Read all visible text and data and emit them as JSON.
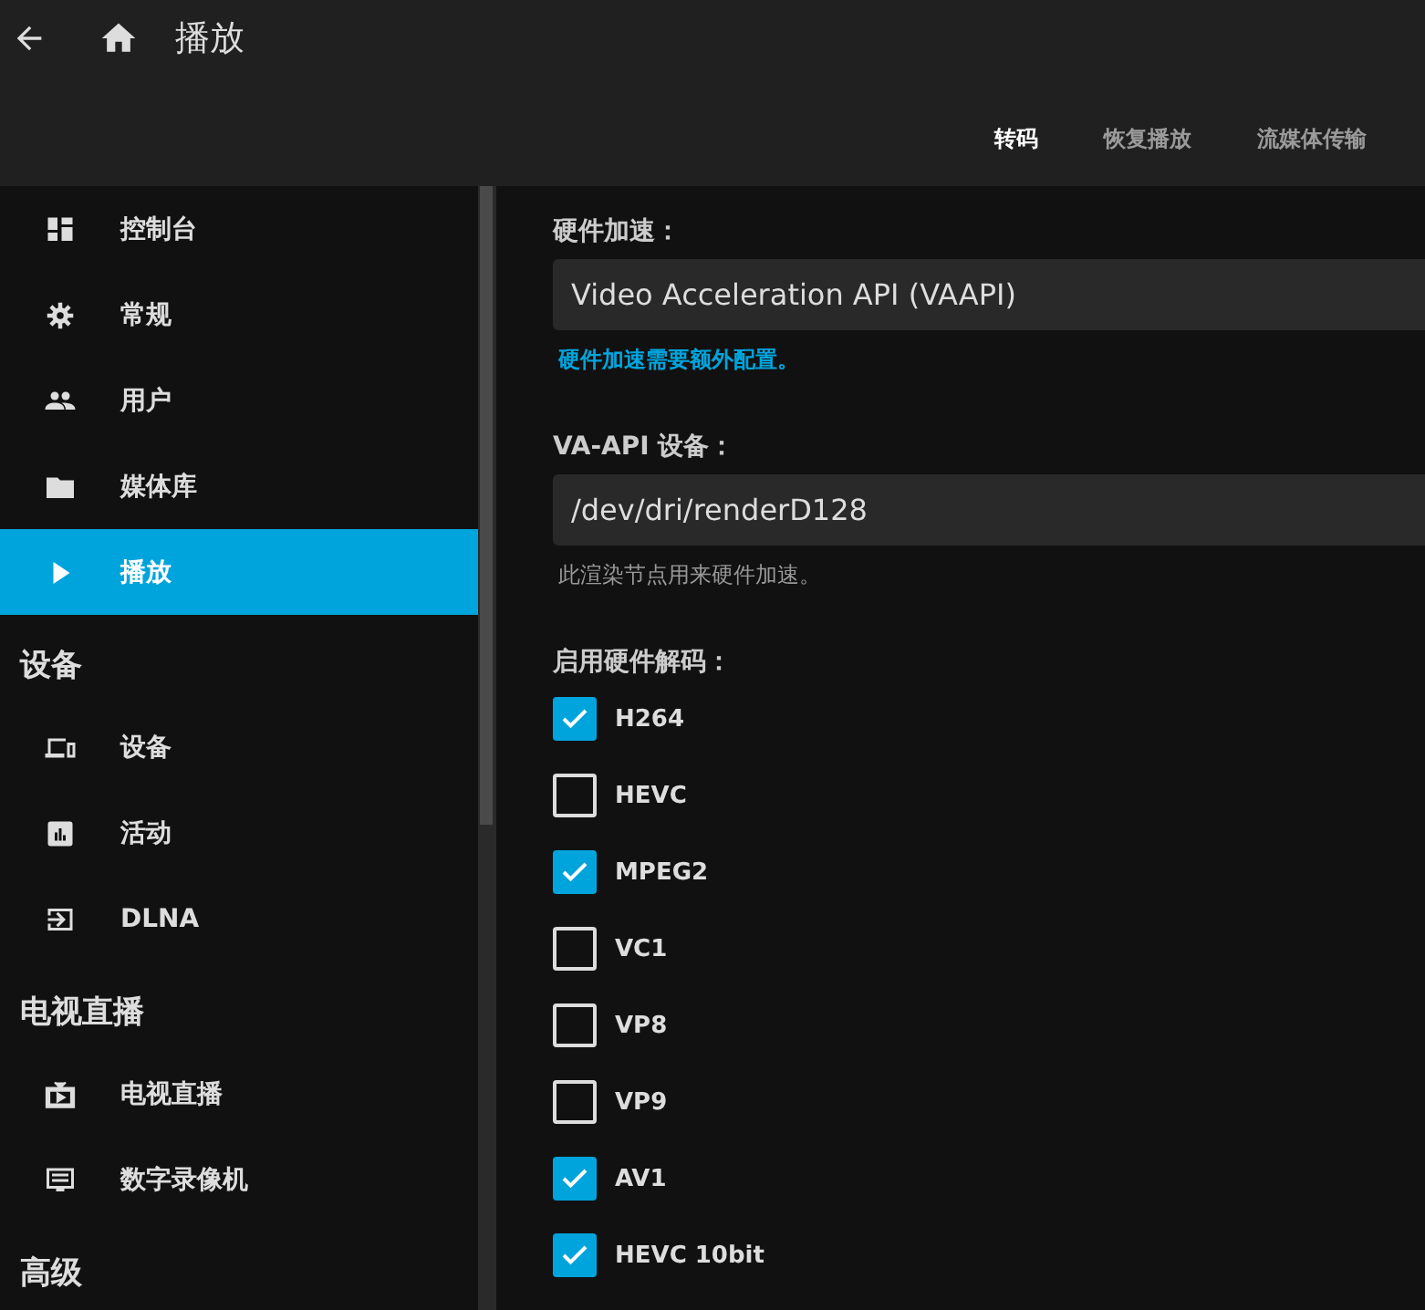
{
  "header": {
    "title": "播放",
    "tabs": [
      {
        "label": "转码",
        "selected": true
      },
      {
        "label": "恢复播放",
        "selected": false
      },
      {
        "label": "流媒体传输",
        "selected": false
      }
    ]
  },
  "sidebar": {
    "sections": [
      {
        "items": [
          {
            "label": "控制台",
            "selected": false
          },
          {
            "label": "常规",
            "selected": false
          },
          {
            "label": "用户",
            "selected": false
          },
          {
            "label": "媒体库",
            "selected": false
          },
          {
            "label": "播放",
            "selected": true
          }
        ]
      },
      {
        "title": "设备",
        "items": [
          {
            "label": "设备",
            "selected": false
          },
          {
            "label": "活动",
            "selected": false
          },
          {
            "label": "DLNA",
            "selected": false
          }
        ]
      },
      {
        "title": "电视直播",
        "items": [
          {
            "label": "电视直播",
            "selected": false
          },
          {
            "label": "数字录像机",
            "selected": false
          }
        ]
      },
      {
        "title": "高级"
      }
    ]
  },
  "content": {
    "hardware_acceleration": {
      "label": "硬件加速：",
      "value": "Video Acceleration API (VAAPI)",
      "note": "硬件加速需要额外配置。"
    },
    "vaapi_device": {
      "label": "VA-API 设备：",
      "value": "/dev/dri/renderD128",
      "hint": "此渲染节点用来硬件加速。"
    },
    "decoding": {
      "label": "启用硬件解码：",
      "codecs": [
        {
          "label": "H264",
          "checked": true
        },
        {
          "label": "HEVC",
          "checked": false
        },
        {
          "label": "MPEG2",
          "checked": true
        },
        {
          "label": "VC1",
          "checked": false
        },
        {
          "label": "VP8",
          "checked": false
        },
        {
          "label": "VP9",
          "checked": false
        },
        {
          "label": "AV1",
          "checked": true
        },
        {
          "label": "HEVC 10bit",
          "checked": true
        }
      ]
    }
  }
}
